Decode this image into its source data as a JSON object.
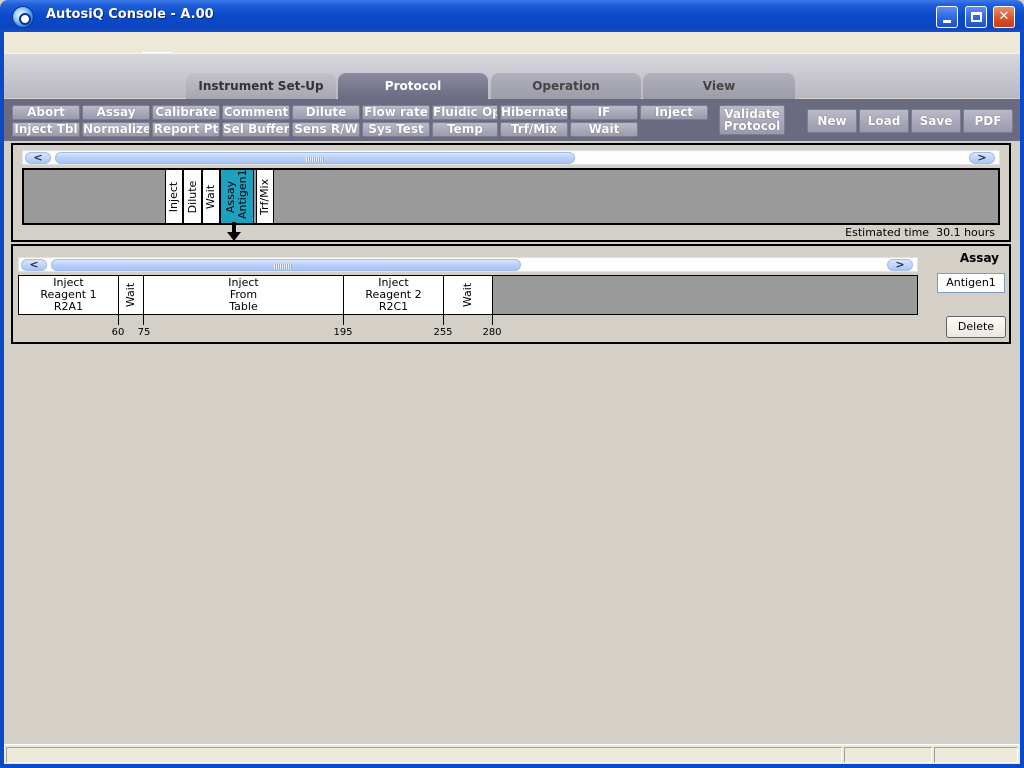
{
  "window": {
    "title": "AutosiQ Console - A.00"
  },
  "tabs": [
    {
      "label": "Instrument Set-Up"
    },
    {
      "label": "Protocol"
    },
    {
      "label": "Operation"
    },
    {
      "label": "View"
    }
  ],
  "toolbar": {
    "row1": [
      "Abort",
      "Assay",
      "Calibrate",
      "Comment",
      "Dilute",
      "Flow rate",
      "Fluidic Op",
      "Hibernate",
      "IF",
      "Inject"
    ],
    "row2": [
      "Inject Tbl",
      "Normalize",
      "Report Pt",
      "Sel Buffer",
      "Sens R/W",
      "Sys Test",
      "Temp",
      "Trf/Mix",
      "Wait"
    ],
    "validate": "Validate Protocol",
    "new": "New",
    "load": "Load",
    "save": "Save",
    "pdf": "PDF"
  },
  "protocol_steps": [
    "Inject",
    "Dilute",
    "Wait",
    "Assay Antigen1",
    "Trf/Mix"
  ],
  "selected_step": "Assay Antigen1",
  "estimated_time": {
    "label": "Estimated time",
    "value": "30.1 hours"
  },
  "assay_panel": {
    "title": "Assay",
    "name_value": "Antigen1",
    "delete_label": "Delete",
    "segments": [
      {
        "label": "Inject Reagent 1 R2A1",
        "lines": [
          "Inject",
          "Reagent 1",
          "R2A1"
        ]
      },
      {
        "label": "Wait",
        "lines": [
          "Wait"
        ]
      },
      {
        "label": "Inject From Table",
        "lines": [
          "Inject",
          "From",
          "Table"
        ]
      },
      {
        "label": "Inject Reagent 2 R2C1",
        "lines": [
          "Inject",
          "Reagent 2",
          "R2C1"
        ]
      },
      {
        "label": "Wait",
        "lines": [
          "Wait"
        ]
      }
    ],
    "ticks": [
      "60",
      "75",
      "195",
      "255",
      "280"
    ]
  },
  "colors": {
    "titlebar": "#0a49c8",
    "toolbar_bg": "#6a6a80",
    "selected_step": "#1ea0c0",
    "panel_bg": "#d4d0c8"
  }
}
